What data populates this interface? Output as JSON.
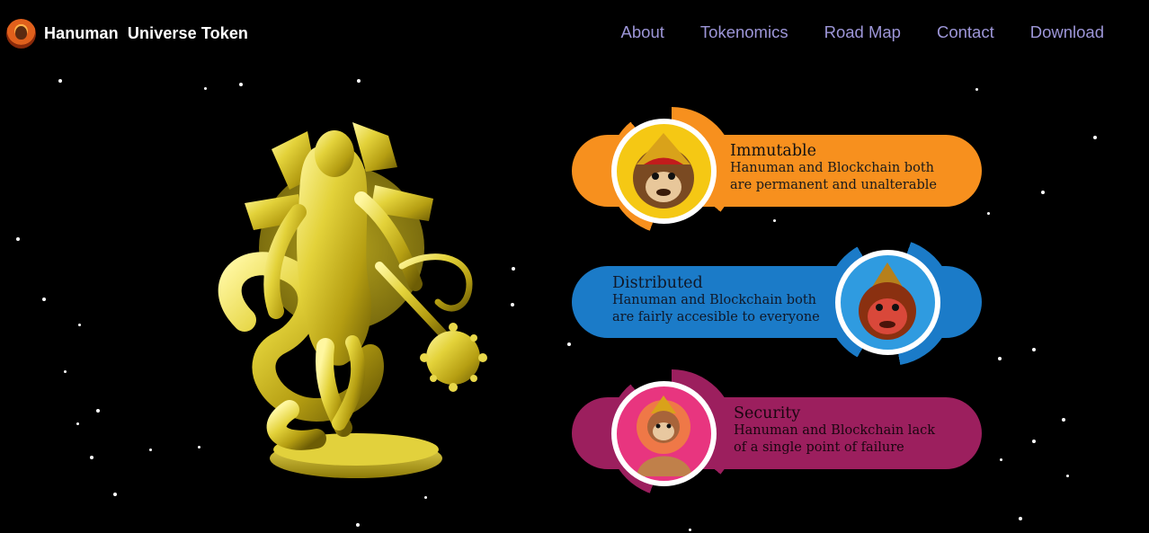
{
  "brand": {
    "name": "Hanuman  Universe Token",
    "logo_icon": "hanuman-logo-icon"
  },
  "nav": {
    "items": [
      {
        "label": "About"
      },
      {
        "label": "Tokenomics"
      },
      {
        "label": "Road Map"
      },
      {
        "label": "Contact"
      },
      {
        "label": "Download"
      }
    ]
  },
  "hero": {
    "image": "golden-hanuman-statue-image"
  },
  "features": [
    {
      "title": "Immutable",
      "line1": "Hanuman and Blockchain both",
      "line2": "are permanent and unalterable",
      "color": "#f7901e",
      "avatar": "hanuman-crown-avatar-icon"
    },
    {
      "title": "Distributed",
      "line1": "Hanuman and Blockchain both",
      "line2": "are fairly accesible to everyone",
      "color": "#1b7bc8",
      "avatar": "hanuman-red-face-avatar-icon"
    },
    {
      "title": "Security",
      "line1": "Hanuman and Blockchain lack",
      "line2": "of a single point of failure",
      "color": "#9c1f5e",
      "avatar": "hanuman-meditating-avatar-icon"
    }
  ]
}
